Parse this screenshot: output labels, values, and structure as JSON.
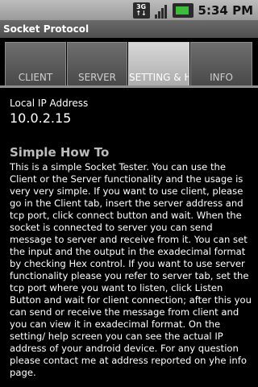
{
  "status_bar": {
    "network_label_top": "3G",
    "network_label_bottom": "↑↓",
    "time": "5:34 PM"
  },
  "app": {
    "title": "Socket Protocol"
  },
  "tabs": [
    {
      "label": "CLIENT",
      "selected": false
    },
    {
      "label": "SERVER",
      "selected": false
    },
    {
      "label": "SETTING & HELP",
      "selected": true
    },
    {
      "label": "INFO",
      "selected": false
    }
  ],
  "content": {
    "ip_label": "Local IP Address",
    "ip_value": "10.0.2.15",
    "howto_title": "Simple How To",
    "howto_text": "This is a simple Socket Tester. You can use the Client or the Server functionality and the usage is very very simple. If you want to use client, please go in the Client tab, insert the server address and tcp port, click connect button and wait. When the socket is connected to server you can send message to server and receive from it. You can set the input and the output in the exadecimal format by checking Hex control. If you want to use server functionality please you refer to server tab, set the tcp port where you want to listen, click Listen Button and wait for client connection; after this you can send or receive the message from client and you can view it in exadecimal format. On the setting/ help screen you can see the actual IP address of your android device. For any question please contact me at address reported on yhe info page."
  },
  "colors": {
    "background": "#000000",
    "status_bar": "#aaaaaa",
    "title_bar": "#5a5a5a",
    "tab_unselected": "#555555",
    "tab_selected": "#bdbdbd",
    "heading": "#bdbdbd",
    "battery_fill": "#3dbb3d"
  }
}
